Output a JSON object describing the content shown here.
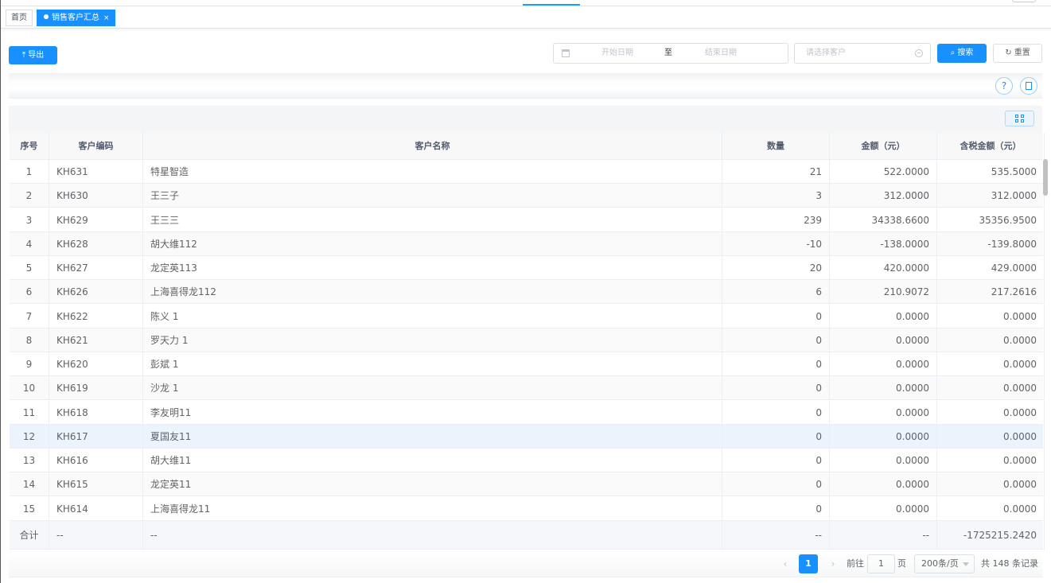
{
  "tabs": [
    {
      "label": "首页"
    },
    {
      "label": "销售客户汇总",
      "close": "×"
    }
  ],
  "toolbar": {
    "export_label": "导出",
    "start_placeholder": "开始日期",
    "range_separator": "至",
    "end_placeholder": "结束日期",
    "customer_placeholder": "请选择客户",
    "search_label": "搜索",
    "reset_label": "重置"
  },
  "right_tools": {
    "help_glyph": "?"
  },
  "table": {
    "columns": [
      "序号",
      "客户编码",
      "客户名称",
      "数量",
      "金额（元）",
      "含税金额（元）"
    ],
    "rows": [
      [
        "1",
        "KH631",
        "特星智造",
        "21",
        "522.0000",
        "535.5000"
      ],
      [
        "2",
        "KH630",
        "王三子",
        "3",
        "312.0000",
        "312.0000"
      ],
      [
        "3",
        "KH629",
        "王三三",
        "239",
        "34338.6600",
        "35356.9500"
      ],
      [
        "4",
        "KH628",
        "胡大维112",
        "-10",
        "-138.0000",
        "-139.8000"
      ],
      [
        "5",
        "KH627",
        "龙定英113",
        "20",
        "420.0000",
        "429.0000"
      ],
      [
        "6",
        "KH626",
        "上海喜得龙112",
        "6",
        "210.9072",
        "217.2616"
      ],
      [
        "7",
        "KH622",
        "陈义 1",
        "0",
        "0.0000",
        "0.0000"
      ],
      [
        "8",
        "KH621",
        "罗天力 1",
        "0",
        "0.0000",
        "0.0000"
      ],
      [
        "9",
        "KH620",
        "彭斌 1",
        "0",
        "0.0000",
        "0.0000"
      ],
      [
        "10",
        "KH619",
        "沙龙 1",
        "0",
        "0.0000",
        "0.0000"
      ],
      [
        "11",
        "KH618",
        "李友明11",
        "0",
        "0.0000",
        "0.0000"
      ],
      [
        "12",
        "KH617",
        "夏国友11",
        "0",
        "0.0000",
        "0.0000"
      ],
      [
        "13",
        "KH616",
        "胡大维11",
        "0",
        "0.0000",
        "0.0000"
      ],
      [
        "14",
        "KH615",
        "龙定英11",
        "0",
        "0.0000",
        "0.0000"
      ],
      [
        "15",
        "KH614",
        "上海喜得龙11",
        "0",
        "0.0000",
        "0.0000"
      ]
    ],
    "highlighted_row": 12,
    "total": [
      "合计",
      "--",
      "--",
      "--",
      "--",
      "-1725215.2420"
    ]
  },
  "pagination": {
    "prev": "‹",
    "current_page": "1",
    "next": "›",
    "goto_label": "前往",
    "goto_value": "1",
    "page_suffix": "页",
    "page_size": "200条/页",
    "total_text": "共 148 条记录"
  },
  "colors": {
    "primary": "#1890ff",
    "highlight_row": "#ebf4fd"
  }
}
